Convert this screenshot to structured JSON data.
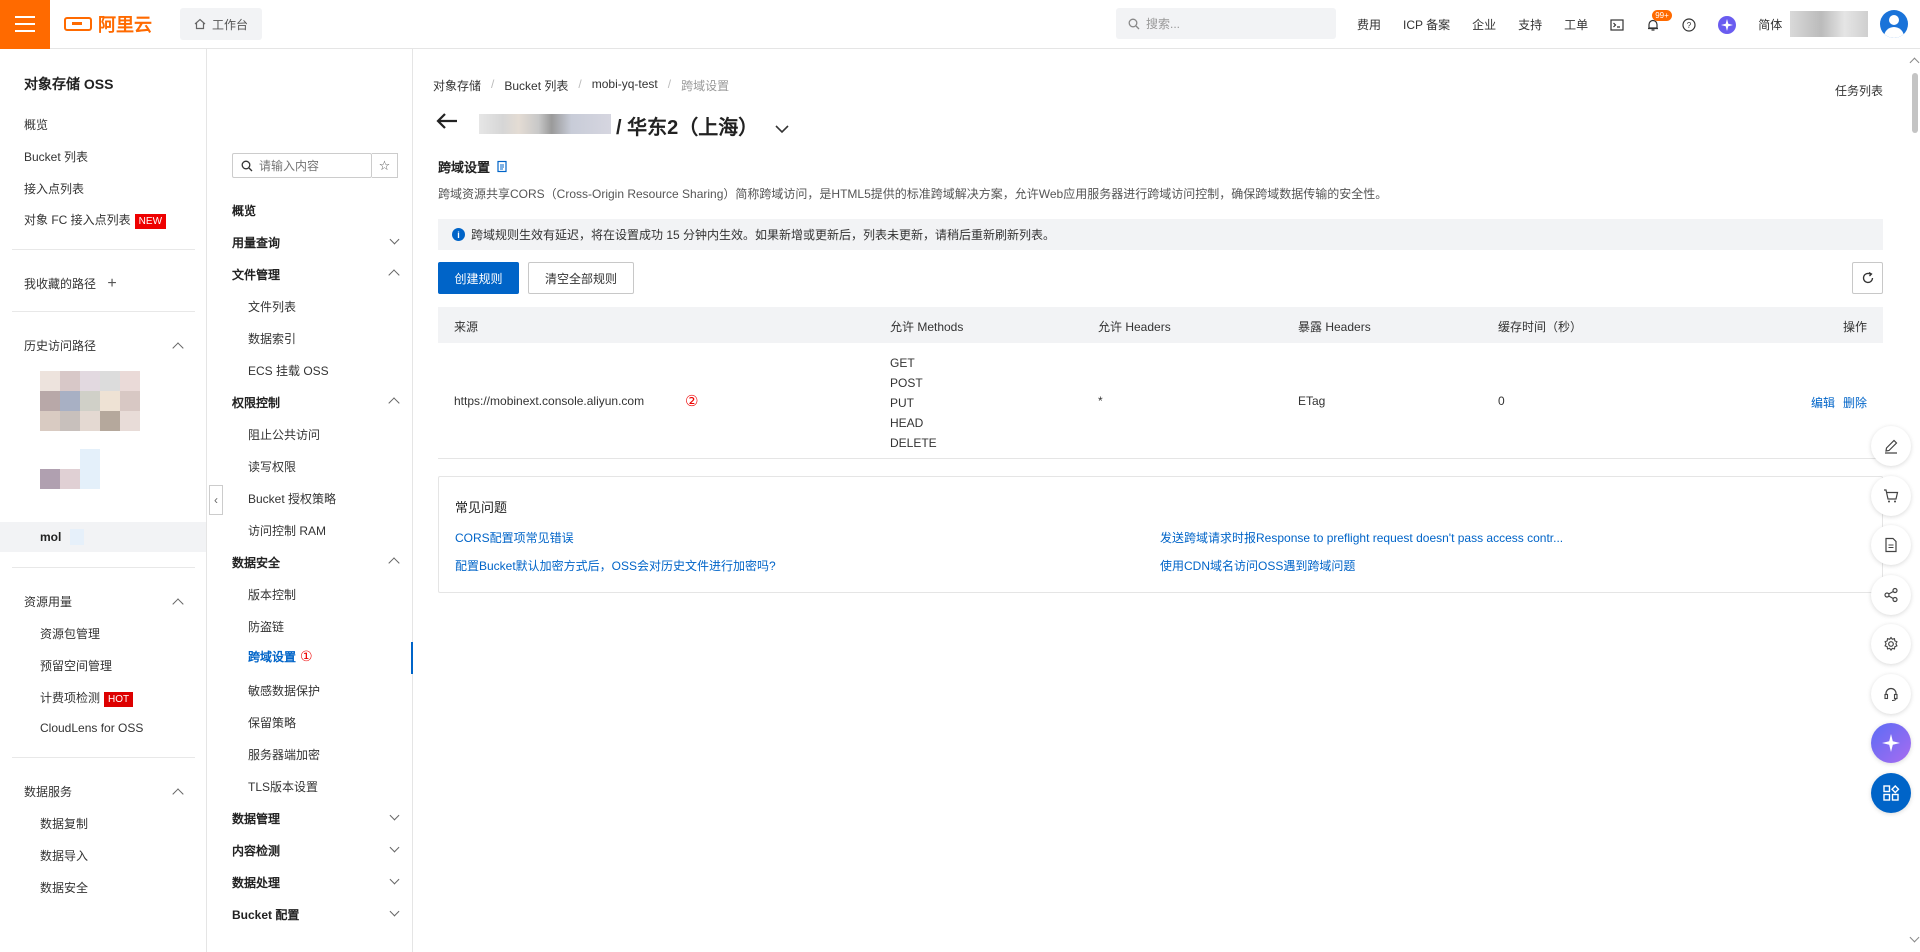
{
  "topbar": {
    "logo_text": "阿里云",
    "workbench_label": "工作台",
    "search_placeholder": "搜索...",
    "links": [
      "费用",
      "ICP 备案",
      "企业",
      "支持",
      "工单"
    ],
    "notification_badge": "99+",
    "language": "简体",
    "accent_color": "#ff6a00"
  },
  "leftnav": {
    "title": "对象存储 OSS",
    "items": [
      {
        "label": "概览"
      },
      {
        "label": "Bucket 列表"
      },
      {
        "label": "接入点列表"
      },
      {
        "label": "对象 FC 接入点列表",
        "tag": "NEW"
      }
    ],
    "favorites_label": "我收藏的路径",
    "history_label": "历史访问路径",
    "history_current": "mol",
    "resource_group": {
      "label": "资源用量",
      "items": [
        {
          "label": "资源包管理"
        },
        {
          "label": "预留空间管理"
        },
        {
          "label": "计费项检测",
          "tag": "HOT"
        },
        {
          "label": "CloudLens for OSS"
        }
      ]
    },
    "data_service_group": {
      "label": "数据服务",
      "items": [
        {
          "label": "数据复制"
        },
        {
          "label": "数据导入"
        },
        {
          "label": "数据安全"
        }
      ]
    }
  },
  "subnav": {
    "search_placeholder": "请输入内容",
    "overview": "概览",
    "groups": [
      {
        "label": "用量查询",
        "expanded": false
      },
      {
        "label": "文件管理",
        "expanded": true,
        "items": [
          "文件列表",
          "数据索引",
          "ECS 挂载 OSS"
        ]
      },
      {
        "label": "权限控制",
        "expanded": true,
        "items": [
          "阻止公共访问",
          "读写权限",
          "Bucket 授权策略",
          "访问控制 RAM"
        ]
      },
      {
        "label": "数据安全",
        "expanded": true,
        "items": [
          "版本控制",
          "防盗链",
          "跨域设置",
          "敏感数据保护",
          "保留策略",
          "服务器端加密",
          "TLS版本设置"
        ]
      },
      {
        "label": "数据管理",
        "expanded": false
      },
      {
        "label": "内容检测",
        "expanded": false
      },
      {
        "label": "数据处理",
        "expanded": false
      },
      {
        "label": "Bucket 配置",
        "expanded": false
      }
    ],
    "active_item": "跨域设置",
    "active_marker": "①"
  },
  "main": {
    "breadcrumb": [
      "对象存储",
      "Bucket 列表",
      "mobi-yq-test",
      "跨域设置"
    ],
    "task_list": "任务列表",
    "bucket_region": "/ 华东2（上海）",
    "section_title": "跨域设置",
    "description": "跨域资源共享CORS（Cross-Origin Resource Sharing）简称跨域访问，是HTML5提供的标准跨域解决方案，允许Web应用服务器进行跨域访问控制，确保跨域数据传输的安全性。",
    "notice": "跨域规则生效有延迟，将在设置成功 15 分钟内生效。如果新增或更新后，列表未更新，请稍后重新刷新列表。",
    "create_button": "创建规则",
    "clear_button": "清空全部规则",
    "table": {
      "headers": [
        "来源",
        "允许 Methods",
        "允许 Headers",
        "暴露 Headers",
        "缓存时间（秒）",
        "操作"
      ],
      "rows": [
        {
          "origin": "https://mobinext.console.aliyun.com",
          "origin_marker": "②",
          "methods": [
            "GET",
            "POST",
            "PUT",
            "HEAD",
            "DELETE"
          ],
          "allow_headers": "*",
          "expose_headers": "ETag",
          "max_age": "0",
          "actions": [
            "编辑",
            "删除"
          ]
        }
      ]
    },
    "faq": {
      "title": "常见问题",
      "links": [
        "CORS配置项常见错误",
        "发送跨域请求时报Response to preflight request doesn't pass access contr...",
        "配置Bucket默认加密方式后，OSS会对历史文件进行加密吗?",
        "使用CDN域名访问OSS遇到跨域问题"
      ]
    }
  },
  "rail_icons": [
    "edit-icon",
    "cart-icon",
    "doc-icon",
    "share-icon",
    "settings-icon",
    "support-icon",
    "ai-assistant-icon",
    "apps-icon"
  ]
}
